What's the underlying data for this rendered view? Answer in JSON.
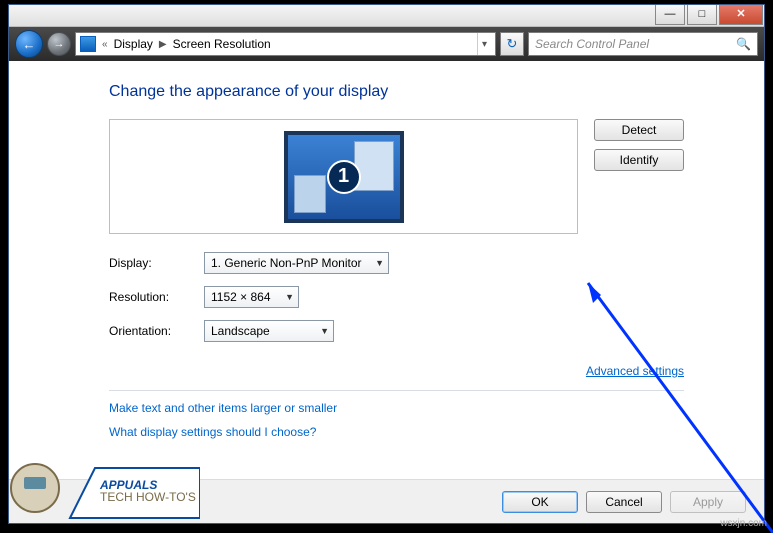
{
  "titlebar": {
    "min": "—",
    "max": "□",
    "close": "✕"
  },
  "nav": {
    "crumb1": "Display",
    "crumb2": "Screen Resolution",
    "search_placeholder": "Search Control Panel"
  },
  "heading": "Change the appearance of your display",
  "monitor_number": "1",
  "buttons": {
    "detect": "Detect",
    "identify": "Identify",
    "ok": "OK",
    "cancel": "Cancel",
    "apply": "Apply"
  },
  "form": {
    "display_label": "Display:",
    "display_value": "1. Generic Non-PnP Monitor",
    "resolution_label": "Resolution:",
    "resolution_value": "1152 × 864",
    "orientation_label": "Orientation:",
    "orientation_value": "Landscape"
  },
  "links": {
    "advanced": "Advanced settings",
    "larger": "Make text and other items larger or smaller",
    "choose": "What display settings should I choose?"
  },
  "watermark": "wsxjn.com",
  "appuals": {
    "name": "APPUALS",
    "tag": "TECH HOW-TO'S FROM THE EXPERTS!"
  }
}
